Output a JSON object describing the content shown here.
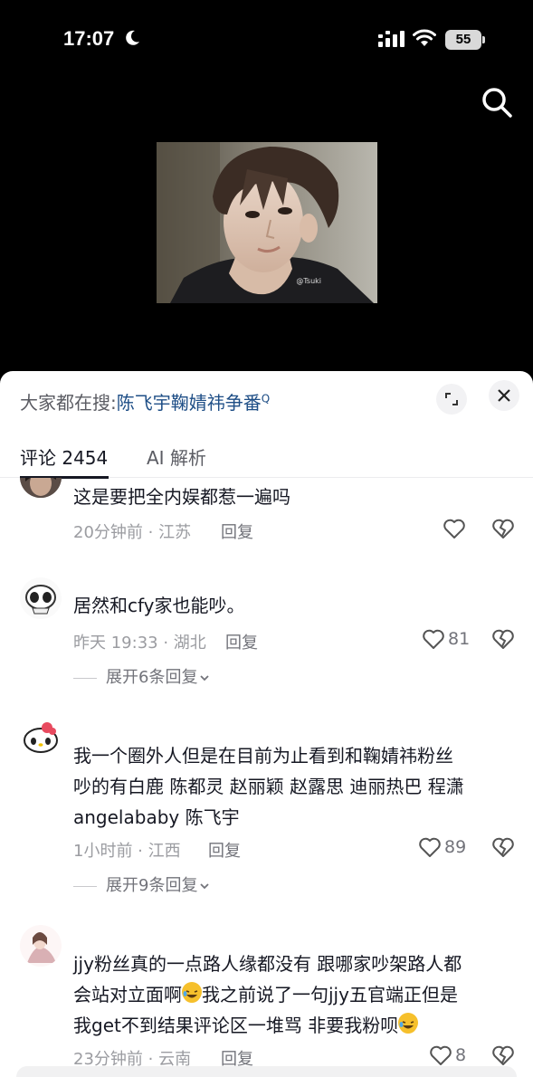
{
  "status_bar": {
    "time": "17:07",
    "battery": "55"
  },
  "sheet": {
    "search_prefix": "大家都在搜:",
    "search_query": "陈飞宇鞠婧祎争番",
    "search_mark": "Q",
    "tabs": [
      {
        "label": "评论 2454",
        "active": true
      },
      {
        "label": "AI 解析",
        "active": false
      }
    ]
  },
  "photo": {
    "watermark": "@Tsuki"
  },
  "comments": [
    {
      "text": "这是要把全内娱都惹一遍吗",
      "meta": "20分钟前 · 江苏",
      "reply": "回复",
      "likes": ""
    },
    {
      "text": "居然和cfy家也能吵。",
      "meta": "昨天 19:33 · 湖北",
      "reply": "回复",
      "likes": "81",
      "expand": "展开6条回复"
    },
    {
      "lines": [
        "我一个圈外人但是在目前为止看到和鞠婧祎粉丝",
        "吵的有白鹿 陈都灵 赵丽颖 赵露思 迪丽热巴 程潇",
        "angelababy 陈飞宇"
      ],
      "meta": "1小时前 · 江西",
      "reply": "回复",
      "likes": "89",
      "expand": "展开9条回复"
    },
    {
      "line1": "jjy粉丝真的一点路人缘都没有 跟哪家吵架路人都",
      "line2a": "会站对立面啊",
      "line2b": "我之前说了一句jjy五官端正但是",
      "line3": "我get不到结果评论区一堆骂 非要我粉呗",
      "meta": "23分钟前 · 云南",
      "reply": "回复",
      "likes": "8"
    }
  ],
  "colors": {
    "sheet_bg": "#ffffff",
    "link": "#1e4e86",
    "muted": "#9b9ca1"
  }
}
